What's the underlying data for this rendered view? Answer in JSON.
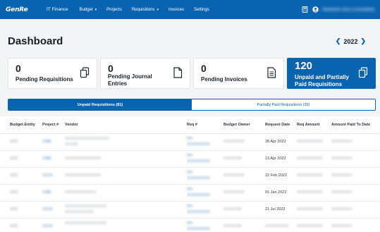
{
  "nav": {
    "logo_text": "GenRe",
    "app_name": "IT Finance",
    "items": [
      {
        "label": "Budget",
        "dropdown": true
      },
      {
        "label": "Projects",
        "dropdown": false
      },
      {
        "label": "Requisitions",
        "dropdown": true
      },
      {
        "label": "Invoices",
        "dropdown": false
      },
      {
        "label": "Settings",
        "dropdown": false
      }
    ],
    "user_name": "Redacted User (Consultant)"
  },
  "header": {
    "title": "Dashboard",
    "year": "2022"
  },
  "cards": [
    {
      "count": "0",
      "label": "Pending Requisitions",
      "icon": "copy-icon"
    },
    {
      "count": "0",
      "label": "Pending Journal Entries",
      "icon": "document-icon"
    },
    {
      "count": "0",
      "label": "Pending Invoices",
      "icon": "invoice-icon"
    },
    {
      "count": "120",
      "label": "Unpaid and Partially Paid Requisitions",
      "icon": "copy-icon"
    }
  ],
  "tabs": [
    {
      "label": "Unpaid Requisitions (81)"
    },
    {
      "label": "Partially Paid Requisitions (39)"
    }
  ],
  "table": {
    "columns": [
      "Budget Entity",
      "Project #",
      "Vendor",
      "Req #",
      "Budget Owner",
      "Request Date",
      "Req Amount",
      "Amount Paid To Date"
    ],
    "rows": [
      {
        "entity": "GRC",
        "project": "2288",
        "vendor1": "XXXXXXXXXXXXXXXXX",
        "vendor2": "XXXXX",
        "req1": "PR-",
        "req2": "XXXXXXXXX",
        "owner": "XXXXXXXX",
        "date": "28 Apr 2022",
        "amount": "XXXXXXXXXX",
        "paid": "XXXXXXXX"
      },
      {
        "entity": "GRC",
        "project": "2289",
        "vendor1": "XXXXXXXXXXXXXX",
        "vendor2": "",
        "req1": "PR-",
        "req2": "XXXXXXXXX",
        "owner": "XXXXXXX",
        "date": "13 Apr 2022",
        "amount": "XXXXXXXXXX",
        "paid": "XXXXXXXX"
      },
      {
        "entity": "GRC",
        "project": "XXXX",
        "vendor1": "XXXXXXXXXXXXXX",
        "vendor2": "",
        "req1": "PR-",
        "req2": "XXXXXXXXX",
        "owner": "XXXXXXXX",
        "date": "22 Feb 2022",
        "amount": "XXXXXXXXXX",
        "paid": "XXXXXXXX"
      },
      {
        "entity": "GRC",
        "project": "2288",
        "vendor1": "XXXXXXXXXXXX",
        "vendor2": "",
        "req1": "PR-",
        "req2": "XXXXXXXXX",
        "owner": "XXXXXXXX",
        "date": "01 Jan 2022",
        "amount": "XXXXXXXXXX",
        "paid": "XXXXXXXX"
      },
      {
        "entity": "GRC",
        "project": "XXXX",
        "vendor1": "XXXXXXXXXXXXXXXX",
        "vendor2": "XXXXXXXXXXX",
        "req1": "PR-",
        "req2": "XXXXXXXXX",
        "owner": "XXXXXXX",
        "date": "21 Jul 2022",
        "amount": "XXXXXXXXXX",
        "paid": "XXXXXXXX"
      },
      {
        "entity": "GRC",
        "project": "XXXX",
        "vendor1": "XXXXXXXXXXXXXXXX",
        "vendor2": "",
        "req1": "PR-",
        "req2": "XXXXXXXXX",
        "owner": "XXXXXXX",
        "date": "XXXXXXXXX",
        "amount": "XXXXXXXXXX",
        "paid": "XXXXXXXX"
      }
    ]
  }
}
